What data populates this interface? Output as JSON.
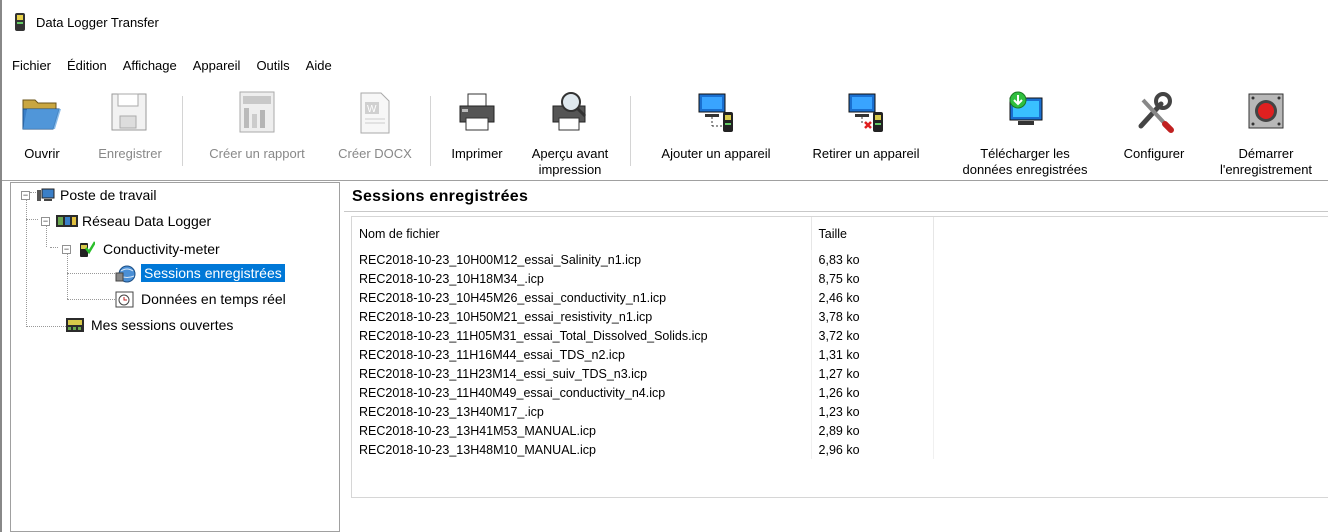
{
  "window": {
    "title": "Data Logger Transfer"
  },
  "menu": [
    "Fichier",
    "Édition",
    "Affichage",
    "Appareil",
    "Outils",
    "Aide"
  ],
  "toolbar": {
    "ouvrir": "Ouvrir",
    "enregistrer": "Enregistrer",
    "creer_rapport": "Créer un rapport",
    "creer_docx": "Créer DOCX",
    "imprimer": "Imprimer",
    "apercu_1": "Aperçu avant",
    "apercu_2": "impression",
    "ajouter": "Ajouter un appareil",
    "retirer": "Retirer un appareil",
    "telecharger_1": "Télécharger les",
    "telecharger_2": "données enregistrées",
    "configurer": "Configurer",
    "demarrer_1": "Démarrer",
    "demarrer_2": "l'enregistrement"
  },
  "tree": {
    "poste": "Poste de travail",
    "reseau": "Réseau Data Logger",
    "device": "Conductivity-meter",
    "sessions": "Sessions enregistrées",
    "temps_reel": "Données en temps réel",
    "mes_sessions": "Mes sessions ouvertes"
  },
  "panel": {
    "title": "Sessions enregistrées",
    "columns": [
      "Nom de fichier",
      "Taille"
    ],
    "rows": [
      [
        "REC2018-10-23_10H00M12_essai_Salinity_n1.icp",
        "6,83 ko"
      ],
      [
        "REC2018-10-23_10H18M34_.icp",
        "8,75 ko"
      ],
      [
        "REC2018-10-23_10H45M26_essai_conductivity_n1.icp",
        "2,46 ko"
      ],
      [
        "REC2018-10-23_10H50M21_essai_resistivity_n1.icp",
        "3,78 ko"
      ],
      [
        "REC2018-10-23_11H05M31_essai_Total_Dissolved_Solids.icp",
        "3,72 ko"
      ],
      [
        "REC2018-10-23_11H16M44_essai_TDS_n2.icp",
        "1,31 ko"
      ],
      [
        "REC2018-10-23_11H23M14_essi_suiv_TDS_n3.icp",
        "1,27 ko"
      ],
      [
        "REC2018-10-23_11H40M49_essai_conductivity_n4.icp",
        "1,26 ko"
      ],
      [
        "REC2018-10-23_13H40M17_.icp",
        "1,23 ko"
      ],
      [
        "REC2018-10-23_13H41M53_MANUAL.icp",
        "2,89 ko"
      ],
      [
        "REC2018-10-23_13H48M10_MANUAL.icp",
        "2,96 ko"
      ]
    ]
  }
}
